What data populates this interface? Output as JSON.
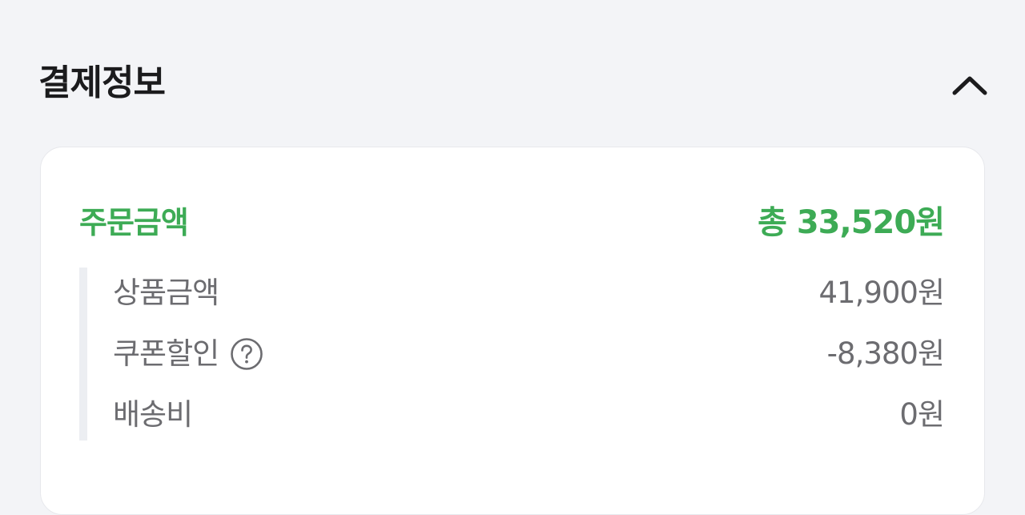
{
  "section": {
    "title": "결제정보",
    "collapse_icon": "chevron-up-icon"
  },
  "order": {
    "label": "주문금액",
    "total": "총 33,520원",
    "accent_color": "#3dab55"
  },
  "details": [
    {
      "label": "상품금액",
      "value": "41,900원"
    },
    {
      "label": "쿠폰할인",
      "value": "-8,380원",
      "info_icon": "question-circle-icon"
    },
    {
      "label": "배송비",
      "value": "0원"
    }
  ]
}
